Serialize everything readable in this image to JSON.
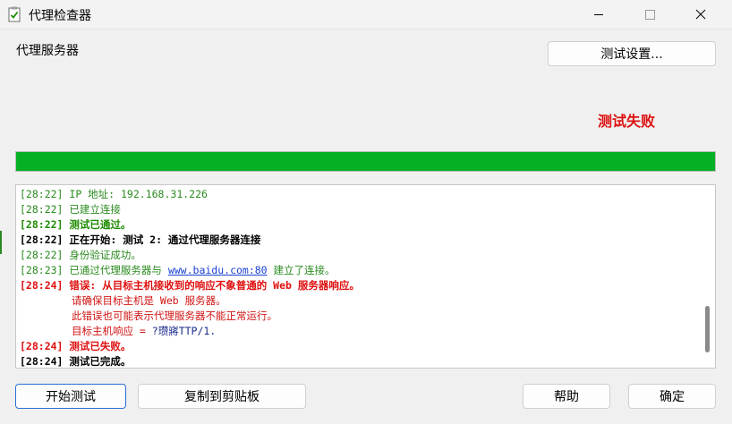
{
  "window": {
    "title": "代理检查器"
  },
  "header": {
    "server_label": "代理服务器",
    "test_settings_button": "测试设置..."
  },
  "status": {
    "text": "测试失败",
    "color": "#dd1111"
  },
  "progress": {
    "value_percent": 100,
    "color": "#06b025"
  },
  "log": {
    "lines": [
      {
        "time": "[28:22]",
        "text": " IP 地址: 192.168.31.226"
      },
      {
        "time": "[28:22]",
        "text": " 已建立连接"
      },
      {
        "time": "[28:22]",
        "text": " 测试已通过。"
      },
      {
        "time": "[28:22]",
        "text": " 正在开始: 测试 2: 通过代理服务器连接"
      },
      {
        "time": "[28:22]",
        "text": " 身份验证成功。"
      },
      {
        "time": "[28:23]",
        "text_before": " 已通过代理服务器与 ",
        "link": "www.baidu.com:80",
        "text_after": " 建立了连接。"
      },
      {
        "time": "[28:24]",
        "text": " 错误: 从目标主机接收到的响应不象普通的 Web 服务器响应。"
      },
      {
        "text": "请确保目标主机是 Web 服务器。"
      },
      {
        "text": "此错误也可能表示代理服务器不能正常运行。"
      },
      {
        "text_before": "目标主机响应 = ",
        "text_after": "?瓒嶈TTP/1."
      },
      {
        "time": "[28:24]",
        "text": " 测试已失败。"
      },
      {
        "time": "[28:24]",
        "text": " 测试已完成。"
      }
    ]
  },
  "footer": {
    "start_button": "开始测试",
    "copy_button": "复制到剪贴板",
    "help_button": "帮助",
    "ok_button": "确定"
  }
}
